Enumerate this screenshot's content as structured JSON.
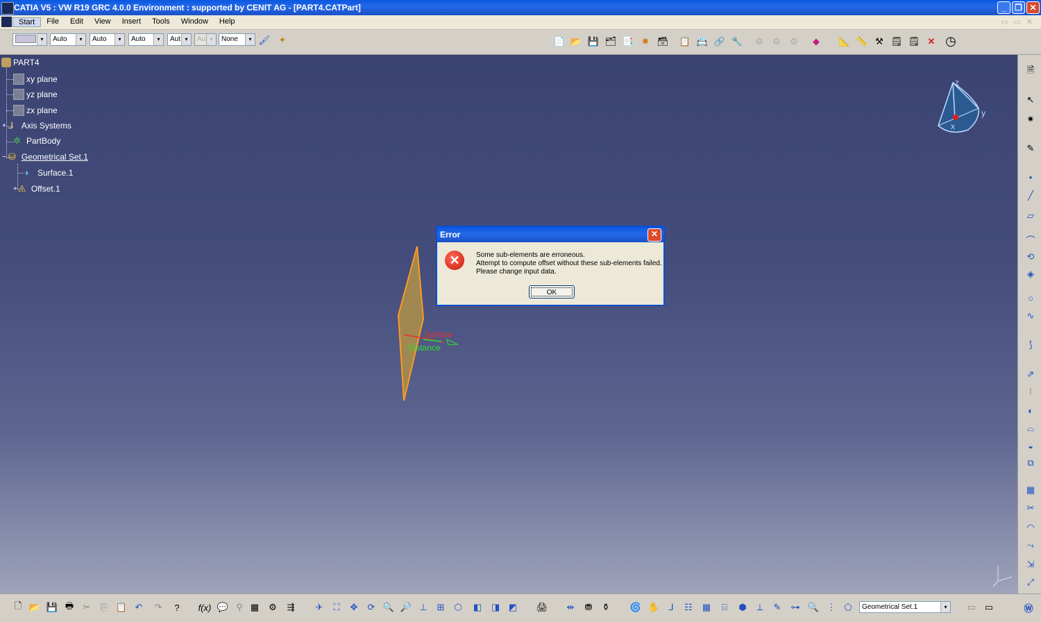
{
  "window": {
    "title": "CATIA V5 : VW R19 GRC 4.0.0 Environment : supported by CENIT AG - [PART4.CATPart]",
    "minimize": "_",
    "restore": "❐",
    "close": "✕"
  },
  "menu": {
    "items": [
      "Start",
      "File",
      "Edit",
      "View",
      "Insert",
      "Tools",
      "Window",
      "Help"
    ]
  },
  "toolbar_top": {
    "combo1": "",
    "combo2": "Auto",
    "combo3": "Auto",
    "combo4": "Auto",
    "combo5": "Aut",
    "combo6": "Aut",
    "combo7": "None",
    "dropdown_arrow": "▾"
  },
  "tree": {
    "root": "PART4",
    "items": [
      "xy plane",
      "yz plane",
      "zx plane",
      "Axis Systems",
      "PartBody",
      "Geometrical Set.1",
      "Surface.1",
      "Offset.1"
    ]
  },
  "viewport": {
    "label_surface": "Surface",
    "label_distance": "Distance",
    "compass_x": "x",
    "compass_y": "y",
    "compass_z": "z"
  },
  "error_dialog": {
    "title": "Error",
    "close": "✕",
    "icon": "✕",
    "line1": "Some sub-elements are erroneous.",
    "line2": "Attempt to compute offset without these sub-elements failed.",
    "line3": "Please change input data.",
    "ok": "OK"
  },
  "bottom_toolbar": {
    "current_set": "Geometrical Set.1",
    "dropdown_arrow": "▾"
  },
  "colors": {
    "titlebar": "#0a58e0",
    "viewport_top": "#3a4372",
    "viewport_bottom": "#9fa3ba",
    "surface_fill": "#a08850",
    "surface_edge": "#ff9a20",
    "label_surface": "#e83030",
    "label_distance": "#30e030"
  }
}
